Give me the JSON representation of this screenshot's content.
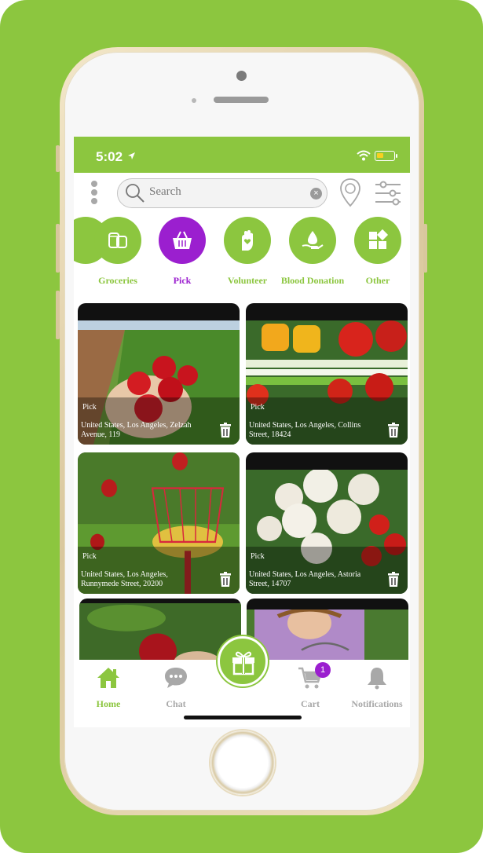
{
  "status_bar": {
    "time": "5:02"
  },
  "search": {
    "placeholder": "Search"
  },
  "categories": [
    {
      "label": "Groceries",
      "icon": "groceries-icon",
      "active": false
    },
    {
      "label": "Pick",
      "icon": "basket-icon",
      "active": true
    },
    {
      "label": "Volunteer",
      "icon": "hand-heart-icon",
      "active": false
    },
    {
      "label": "Blood Donation",
      "icon": "blood-drop-hand-icon",
      "active": false
    },
    {
      "label": "Other",
      "icon": "shapes-icon",
      "active": false
    }
  ],
  "listings": [
    {
      "type": "Pick",
      "address": "United States, Los Angeles, Zelzah Avenue, 119",
      "image": "strawberries"
    },
    {
      "type": "Pick",
      "address": "United States, Los Angeles, Collins Street, 18424",
      "image": "vegetables"
    },
    {
      "type": "Pick",
      "address": "United States, Los Angeles, Runnymede Street, 20200",
      "image": "apple-picker"
    },
    {
      "type": "Pick",
      "address": "United States, Los Angeles, Astoria Street, 14707",
      "image": "cauliflower"
    },
    {
      "type": "",
      "address": "",
      "image": "apple-tree"
    },
    {
      "type": "",
      "address": "",
      "image": "girl-basket"
    }
  ],
  "bottom_nav": {
    "home": "Home",
    "chat": "Chat",
    "cart": "Cart",
    "cart_count": "1",
    "notifications": "Notifications"
  },
  "colors": {
    "brand_green": "#8cc63f",
    "accent_purple": "#9b1fcf"
  }
}
